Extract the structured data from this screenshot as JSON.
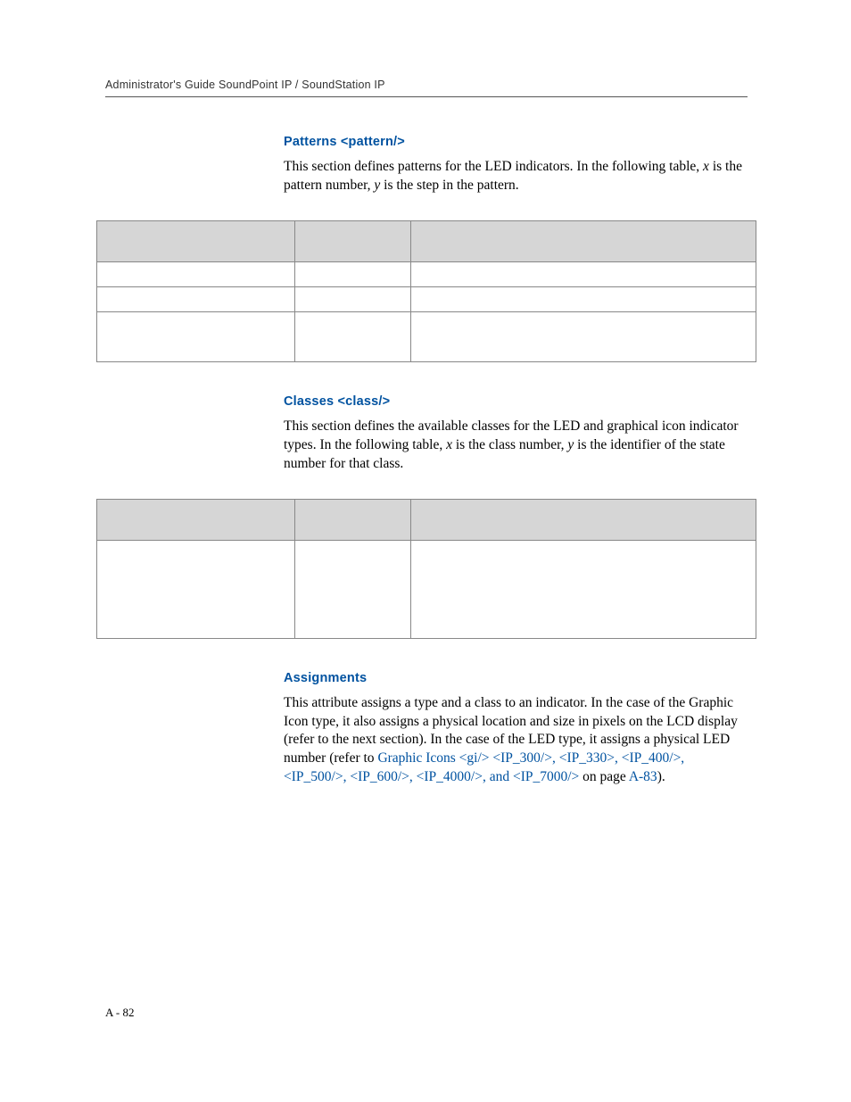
{
  "header": "Administrator's Guide SoundPoint IP / SoundStation IP",
  "s1": {
    "title": "Patterns <pattern/>",
    "p_a": "This section defines patterns for the LED indicators. In the following table, ",
    "x": "x",
    "p_b": " is the pattern number, ",
    "y": "y",
    "p_c": " is the step in the pattern."
  },
  "s2": {
    "title": "Classes <class/>",
    "p_a": "This section defines the available classes for the LED and graphical icon indicator types. In the following table, ",
    "x": "x",
    "p_b": " is the class number, ",
    "y": "y",
    "p_c": " is the identifier of the state number for that class."
  },
  "s3": {
    "title": "Assignments",
    "p_a": "This attribute assigns a type and a class to an indicator. In the case of the Graphic Icon type, it also assigns a physical location and size in pixels on the LCD display (refer to the next section). In the case of the LED type, it assigns a physical LED number (refer to ",
    "link": "Graphic Icons <gi/> <IP_300/>, <IP_330>, <IP_400/>, <IP_500/>, <IP_600/>, <IP_4000/>, and <IP_7000/>",
    "p_b": " on page ",
    "pageref": "A-83",
    "p_c": ")."
  },
  "pagenum": "A - 82"
}
